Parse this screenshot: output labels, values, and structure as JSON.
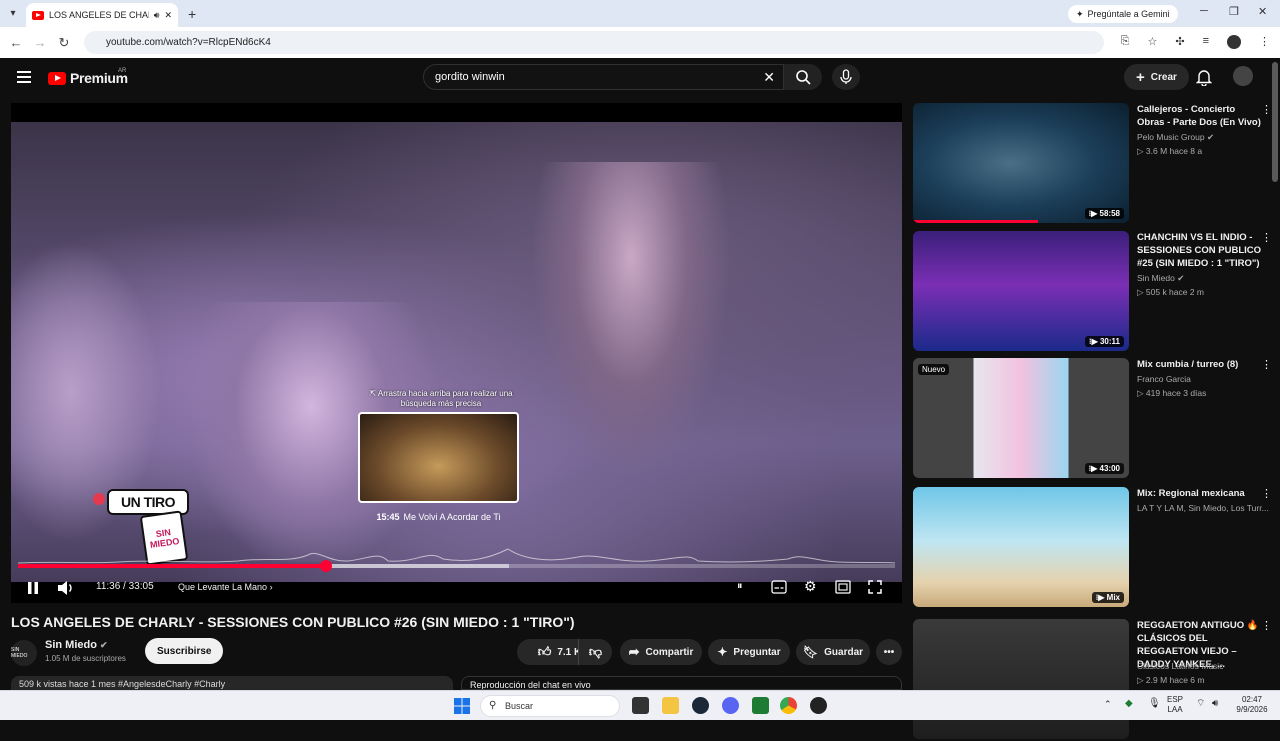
{
  "browser": {
    "tab_title": "LOS ANGELES DE CHARLY -",
    "new_tab": "+",
    "gemini": "Pregúntale a Gemini",
    "url": "youtube.com/watch?v=RlcpENd6cK4"
  },
  "header": {
    "logo_text": "Premium",
    "logo_region": "AR",
    "search_value": "gordito winwin",
    "create_label": "Crear"
  },
  "player": {
    "hint": "⇱ Arrastra hacia arriba para realizar una búsqueda más precisa",
    "preview_time": "15:45",
    "preview_title": "Me Volvi A Acordar de Ti",
    "sticker_top": "UN TIRO",
    "sticker_bottom": "SIN MIEDO",
    "current_time": "11:36",
    "duration": "33:05",
    "time_display": "11:36 / 33:05",
    "chapter": "Que Levante La Mano",
    "progress_played": 0.351,
    "progress_buffered": 0.56,
    "hover_position": 0.48
  },
  "video": {
    "title": "LOS ANGELES DE CHARLY - SESSIONES CON PUBLICO #26 (SIN MIEDO : 1 \"TIRO\")",
    "channel": "Sin Miedo",
    "channel_avatar": "SIN MIEDO",
    "subscribers": "1.05 M de suscriptores",
    "subscribe_label": "Suscribirse",
    "likes": "7.1 K",
    "share_label": "Compartir",
    "ask_label": "Preguntar",
    "save_label": "Guardar",
    "meta": "509 k vistas  hace 1 mes  #AngelesdeCharly #Charly",
    "chat": "Reproducción del chat en vivo"
  },
  "recommendations": [
    {
      "title": "Callejeros - Concierto Obras - Parte Dos (En Vivo)",
      "channel": "Pelo Music Group",
      "verified": true,
      "stats": "▷ 3.6 M  hace 8 a",
      "duration": "58:58",
      "badge": "",
      "watched": 0.58
    },
    {
      "title": "CHANCHIN VS EL INDIO - SESSIONES CON PUBLICO #25 (SIN MIEDO : 1 \"TIRO\")",
      "channel": "Sin Miedo",
      "verified": true,
      "stats": "▷ 505 k  hace 2 m",
      "duration": "30:11",
      "badge": "",
      "watched": 0
    },
    {
      "title": "Mix cumbia / turreo (8)",
      "channel": "Franco Garcia",
      "verified": false,
      "stats": "▷ 419  hace 3 días",
      "duration": "43:00",
      "badge": "Nuevo",
      "watched": 0
    },
    {
      "title": "Mix: Regional mexicana",
      "channel": "LA T Y LA M, Sin Miedo, Los Turr...",
      "verified": false,
      "stats": "",
      "duration": "Mix",
      "badge": "",
      "watched": 0
    },
    {
      "title": "REGGAETON ANTIGUO 🔥 CLÁSICOS DEL REGGAETON VIEJO – DADDY YANKEE, ...",
      "channel": "Clásicos Latinos Music",
      "verified": false,
      "stats": "▷ 2.9 M  hace 6 m",
      "duration": "",
      "badge": "",
      "watched": 0
    }
  ],
  "taskbar": {
    "search_placeholder": "Buscar",
    "lang_top": "ESP",
    "lang_bottom": "LAA",
    "time": "02:47",
    "date": "9/9/2026"
  },
  "colors": {
    "accent_red": "#ff0033",
    "background": "#0f0f0f",
    "pill": "#272727"
  }
}
